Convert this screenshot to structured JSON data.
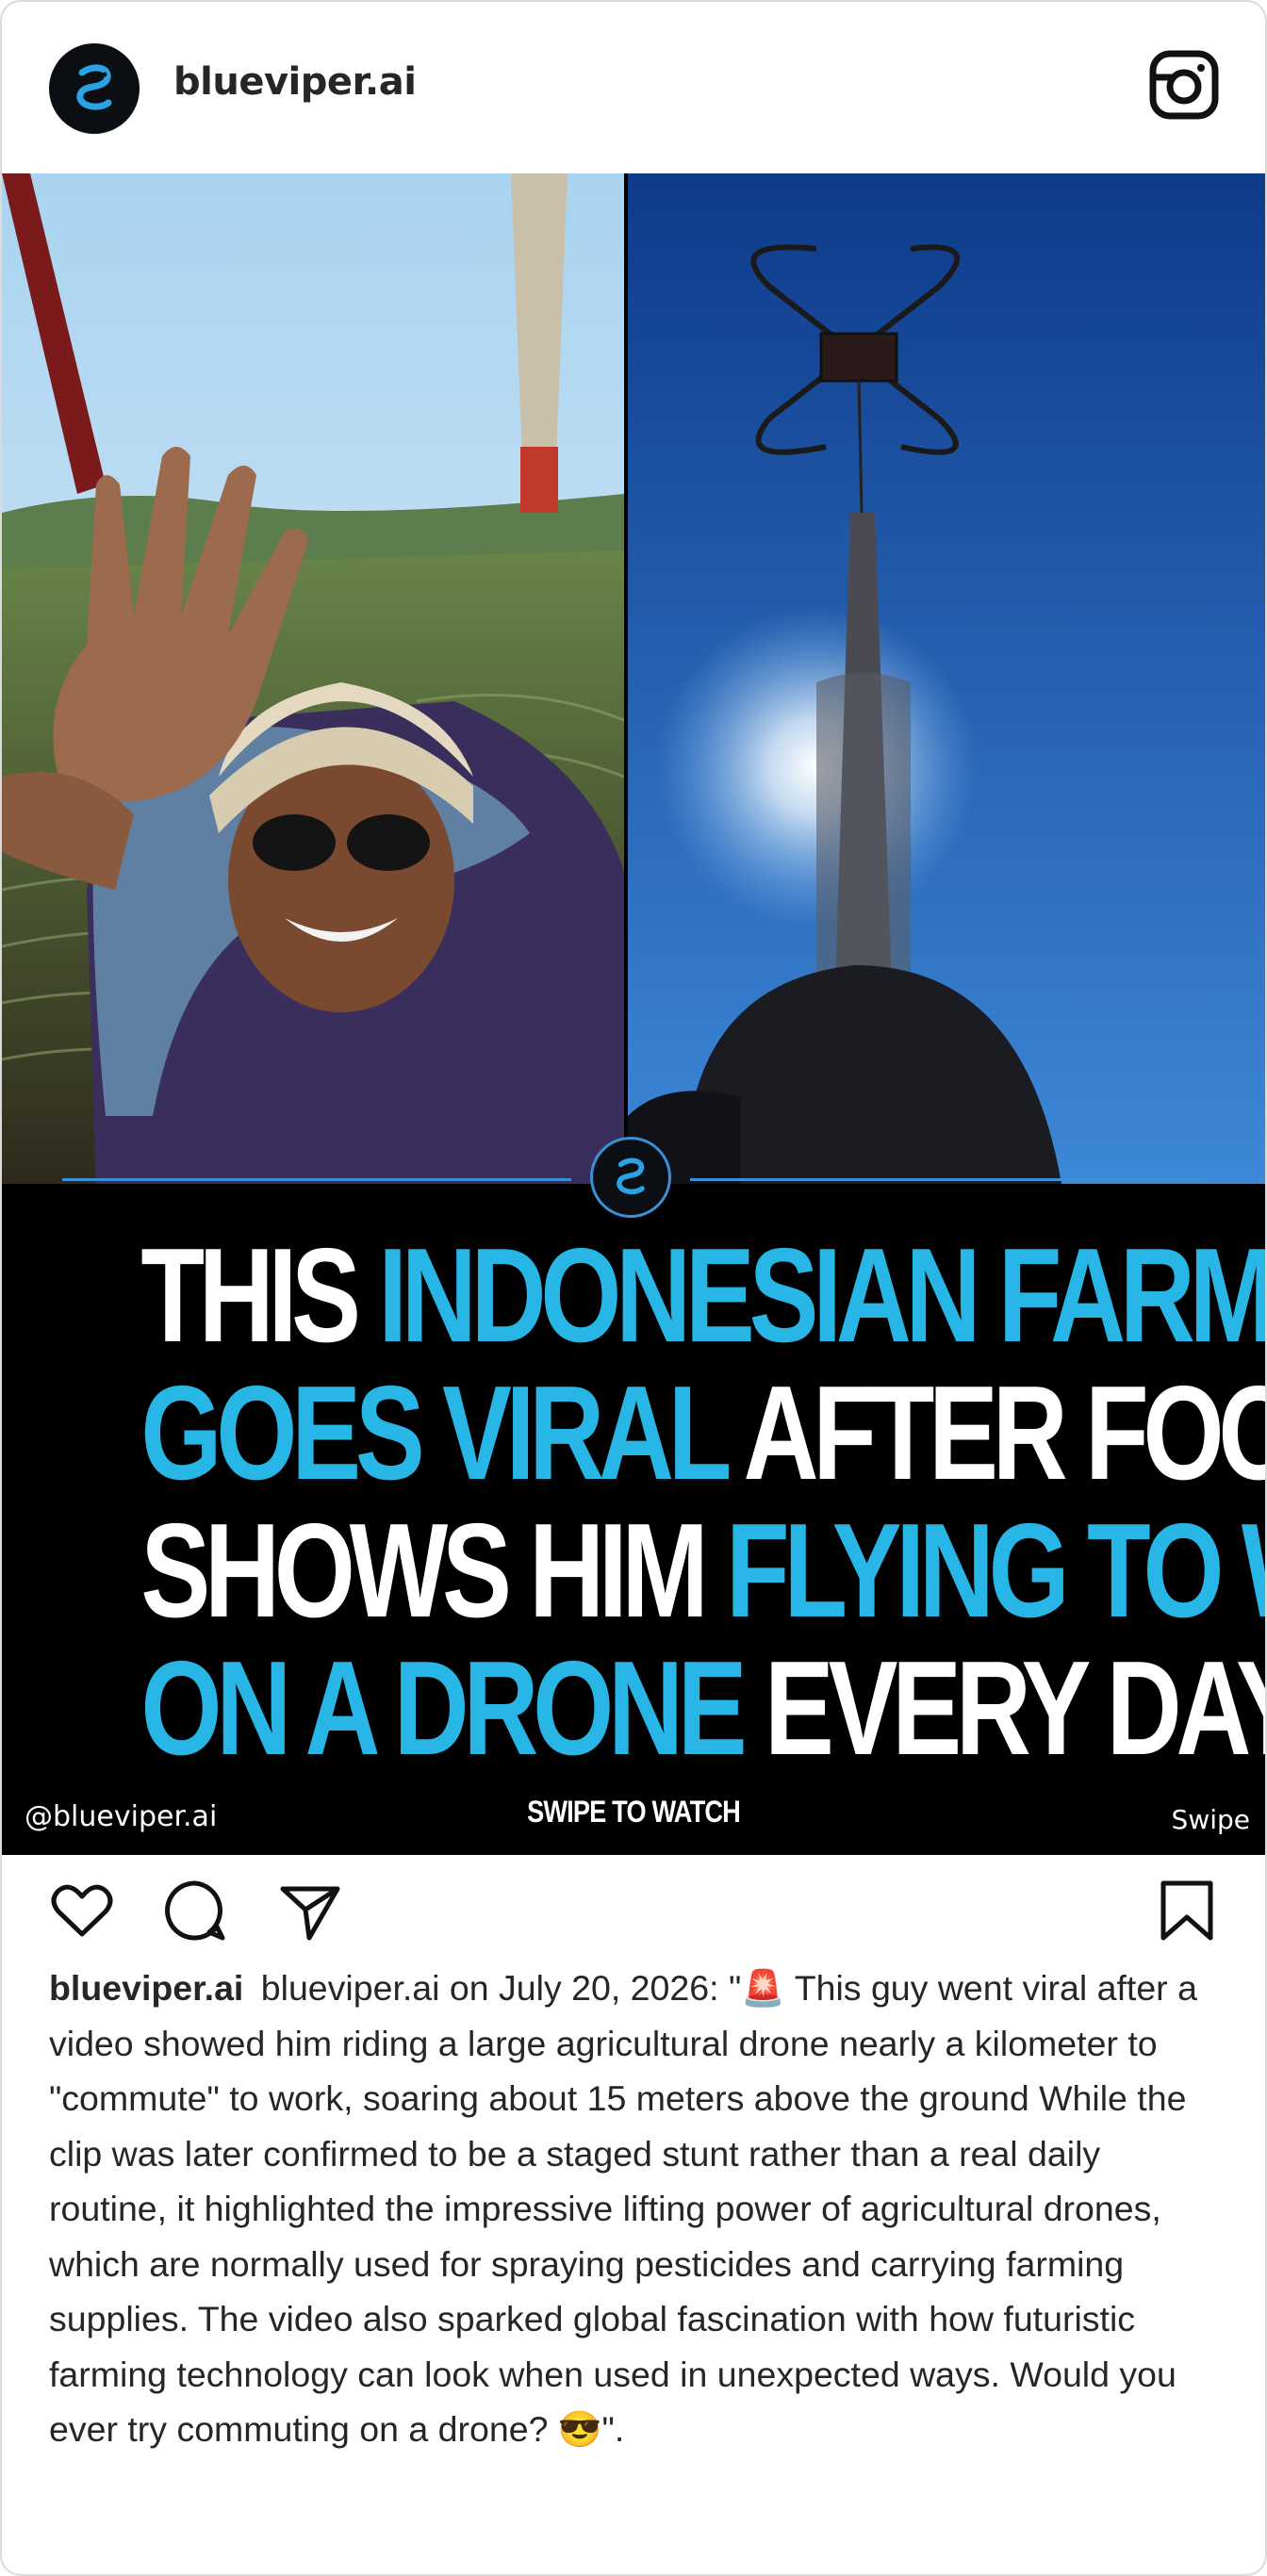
{
  "header": {
    "username": "blueviper.ai",
    "avatar_icon": "blue-serpent-logo-icon",
    "platform_icon": "instagram-icon"
  },
  "media": {
    "headline_lines": [
      [
        {
          "text": "THIS ",
          "color": "white"
        },
        {
          "text": "INDONESIAN FARMER",
          "color": "blue"
        }
      ],
      [
        {
          "text": "GOES VIRAL ",
          "color": "blue"
        },
        {
          "text": "AFTER FOOTAGE",
          "color": "white"
        }
      ],
      [
        {
          "text": "SHOWS HIM ",
          "color": "white"
        },
        {
          "text": "FLYING TO WORK",
          "color": "blue"
        }
      ],
      [
        {
          "text": "ON A DRONE ",
          "color": "blue"
        },
        {
          "text": "EVERY DAY",
          "color": "white"
        }
      ]
    ],
    "handle": "@blueviper.ai",
    "center_text": "SWIPE TO WATCH",
    "swipe_label": "Swipe",
    "accent_blue": "#27b6e6",
    "line_blue": "#3b8fd6"
  },
  "actions": {
    "like_icon": "heart-icon",
    "comment_icon": "comment-icon",
    "share_icon": "send-icon",
    "save_icon": "bookmark-icon"
  },
  "caption": {
    "username": "blueviper.ai",
    "text": "blueviper.ai on July 20, 2026: \"🚨 This guy went viral after a video showed him riding a large agricultural drone nearly a kilometer to \"commute\" to work, soaring about 15 meters above the ground While the clip was later confirmed to be a staged stunt rather than a real daily routine, it highlighted the impressive lifting power of agricultural drones, which are normally used for spraying pesticides and carrying farming supplies. The video also sparked global fascination with how futuristic farming technology can look when used in unexpected ways. Would you ever try commuting on a drone? 😎\"."
  }
}
